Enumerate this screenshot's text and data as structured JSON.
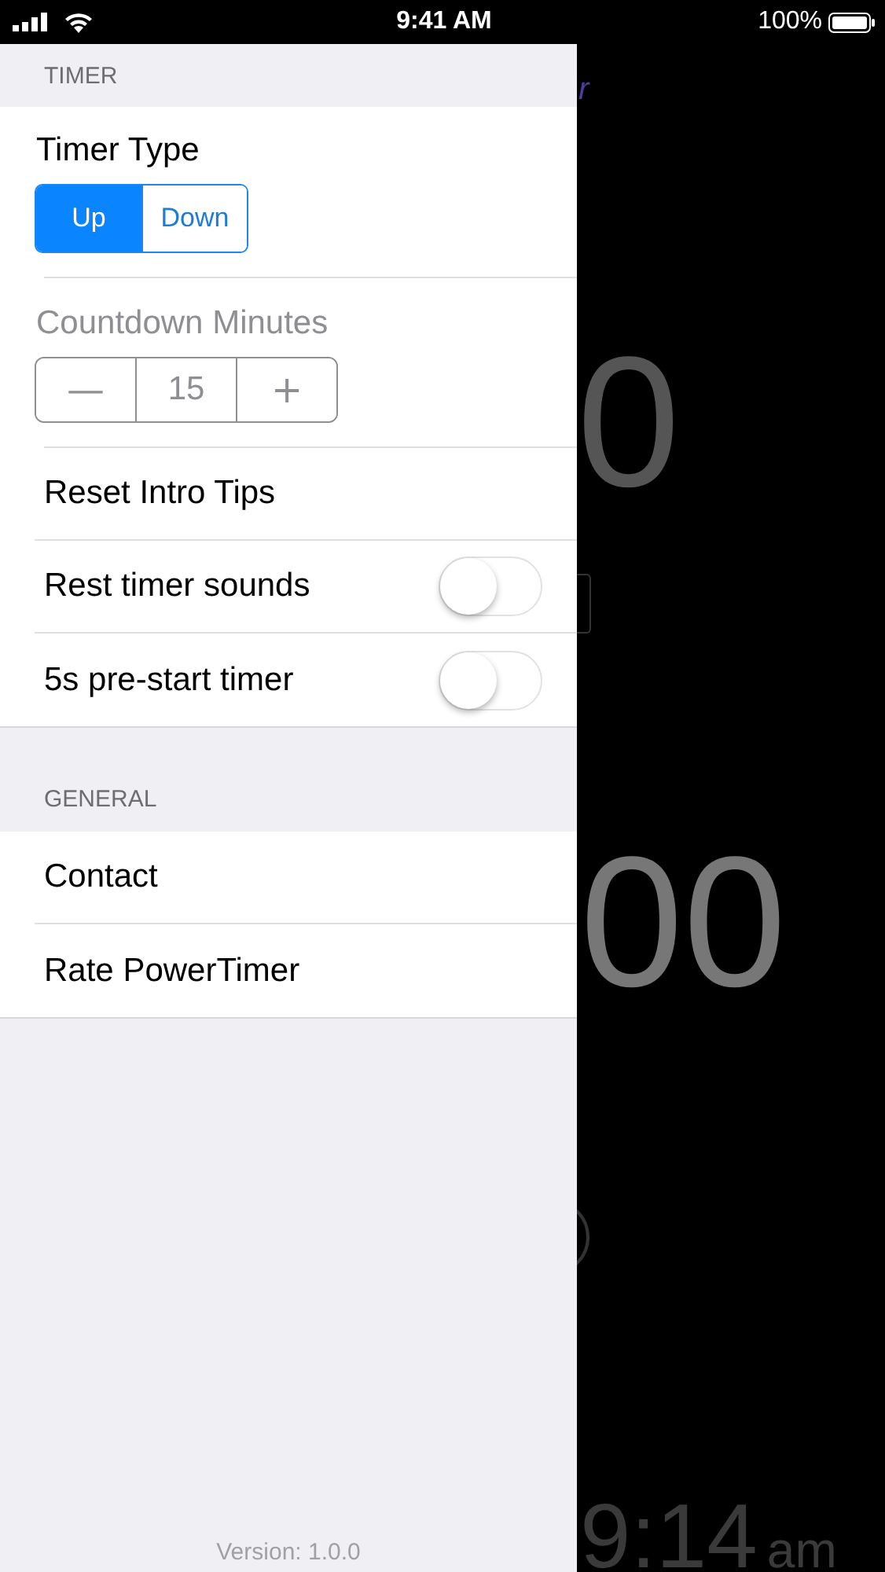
{
  "status_bar": {
    "time": "9:41 AM",
    "battery": "100%"
  },
  "settings": {
    "sections": [
      {
        "header": "TIMER",
        "rows": [
          {
            "kind": "segmented",
            "label": "Timer Type",
            "disabled": false,
            "options": [
              {
                "label": "Up",
                "selected": true
              },
              {
                "label": "Down",
                "selected": false
              }
            ]
          },
          {
            "kind": "stepper",
            "label": "Countdown Minutes",
            "disabled": true,
            "minus": "—",
            "value": "15",
            "plus": "+"
          },
          {
            "kind": "action",
            "label": "Reset Intro Tips"
          },
          {
            "kind": "toggle",
            "label": "Rest timer sounds",
            "on": false
          },
          {
            "kind": "toggle",
            "label": "5s pre-start timer",
            "on": false
          }
        ]
      },
      {
        "header": "GENERAL",
        "rows": [
          {
            "kind": "action",
            "label": "Contact"
          },
          {
            "kind": "action",
            "label": "Rate PowerTimer"
          }
        ]
      }
    ],
    "version": "Version: 1.0.0"
  },
  "background": {
    "title_fragment": "r",
    "countdown_fragment": "0",
    "elapsed_fragment": "00",
    "clock": "9:14",
    "clock_suffix": "am"
  }
}
